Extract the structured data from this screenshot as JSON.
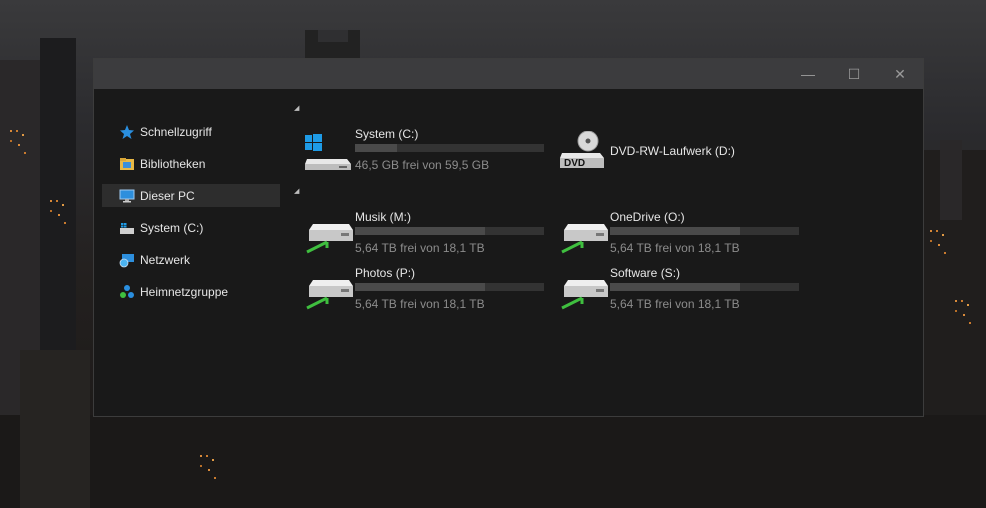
{
  "window": {
    "controls": {
      "minimize_glyph": "—",
      "maximize_glyph": "☐",
      "close_glyph": "✕"
    }
  },
  "nav": {
    "items": [
      {
        "label": "Schnellzugriff",
        "icon": "star-pin-icon",
        "selected": false
      },
      {
        "label": "Bibliotheken",
        "icon": "libraries-folder-icon",
        "selected": false
      },
      {
        "label": "Dieser PC",
        "icon": "computer-monitor-icon",
        "selected": true
      },
      {
        "label": "System (C:)",
        "icon": "system-drive-icon",
        "selected": false
      },
      {
        "label": "Netzwerk",
        "icon": "network-globe-icon",
        "selected": false
      },
      {
        "label": "Heimnetzgruppe",
        "icon": "homegroup-icon",
        "selected": false
      }
    ]
  },
  "groups": {
    "collapse_glyph": "◢"
  },
  "drives": {
    "system": {
      "name": "System (C:)",
      "free": "46,5 GB frei von 59,5 GB",
      "used_fraction": 0.22
    },
    "dvd": {
      "name": "DVD-RW-Laufwerk (D:)",
      "badge": "DVD"
    },
    "musik": {
      "name": "Musik (M:)",
      "free": "5,64 TB frei von 18,1 TB",
      "used_fraction": 0.69
    },
    "onedrive": {
      "name": "OneDrive (O:)",
      "free": "5,64 TB frei von 18,1 TB",
      "used_fraction": 0.69
    },
    "photos": {
      "name": "Photos (P:)",
      "free": "5,64 TB frei von 18,1 TB",
      "used_fraction": 0.69
    },
    "software": {
      "name": "Software (S:)",
      "free": "5,64 TB frei von 18,1 TB",
      "used_fraction": 0.69
    }
  },
  "colors": {
    "window_bg": "#191919",
    "selected_bg": "#2d2d2d",
    "bar_track": "#333333",
    "bar_fill": "#4a4a4a",
    "windows_blue": "#1e9be6",
    "network_green": "#3fbf3f"
  }
}
